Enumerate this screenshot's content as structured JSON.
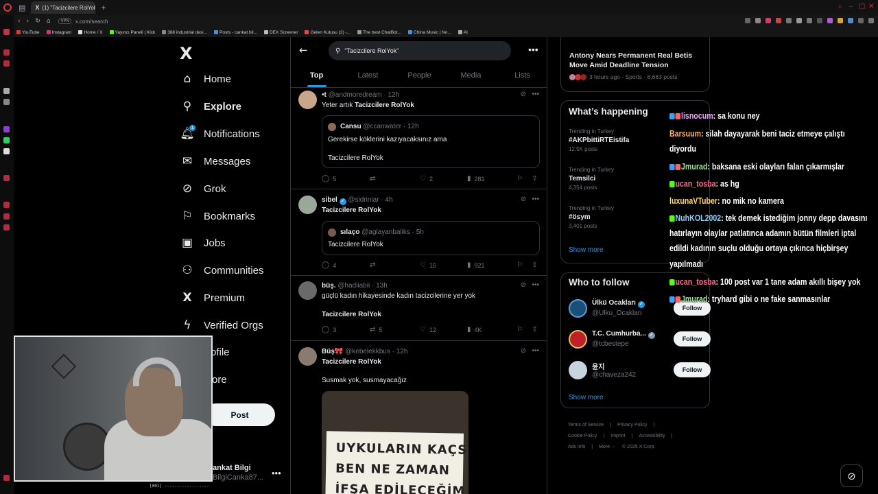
{
  "browser": {
    "tab_title": "(1) \"Tacizcilere RolYok\" -",
    "new_tab_symbol": "+",
    "url": "x.com/search",
    "vpn_label": "VPN",
    "bookmarks": [
      "YouTube",
      "Instagram",
      "Home / X",
      "Yayıncı Paneli | Kick",
      "388 industrial desi...",
      "Posts - cankat bil...",
      "DEX Screener",
      "Gelen Kutusu (2) -...",
      "The best ChatBot...",
      "China Music | No...",
      "AI"
    ]
  },
  "nav": {
    "logo": "X",
    "items": [
      "Home",
      "Explore",
      "Notifications",
      "Messages",
      "Grok",
      "Bookmarks",
      "Jobs",
      "Communities",
      "Premium",
      "Verified Orgs",
      "ofile",
      "ore"
    ],
    "notif_count": "1",
    "post_label": "Post",
    "profile_name": "ankat Bilgi",
    "profile_handle": "BilgiCanka87...",
    "profile_more": "•••"
  },
  "search": {
    "query": "\"Tacizcilere RolYok\"",
    "more": "•••",
    "tabs": [
      "Top",
      "Latest",
      "People",
      "Media",
      "Lists"
    ]
  },
  "tweets": [
    {
      "name": "•t",
      "handle": "@andmoredream",
      "time": "· 12h",
      "text": "Yeter artık ",
      "text_bold": "Tacizcilere RolYok",
      "quote": {
        "name": "Cansu",
        "handle": "@ccanwater",
        "time": "· 12h",
        "line1": "Gerekirse köklerini kazıyacaksınız ama",
        "line2": "Tacizcilere RolYok"
      },
      "replies": "5",
      "reposts": "",
      "likes": "2",
      "views": "281"
    },
    {
      "name": "sibel",
      "handle": "@sidriniar",
      "time": "· 4h",
      "text": "Tacizcilere RolYok",
      "quote": {
        "name": "sılaço",
        "handle": "@aglayanbaliks",
        "time": "· 5h",
        "line1": "Tacizcilere RolYok"
      },
      "replies": "4",
      "reposts": "",
      "likes": "15",
      "views": "921"
    },
    {
      "name": "büş.",
      "handle": "@hadiiabii",
      "time": "· 13h",
      "text": "güçlü kadın hikayesinde kadın tacizcilerine yer yok",
      "text2": "Tacizcilere RolYok",
      "replies": "3",
      "reposts": "5",
      "likes": "12",
      "views": "4K"
    },
    {
      "name": "Büş🎀",
      "handle": "@kebelekkbus",
      "time": "· 12h",
      "text": "Tacizcilere RolYok",
      "text2": "Susmak yok, susmayacağız",
      "sign_lines": [
        "UYKULARIN KAÇSIN",
        "BEN NE ZAMAN",
        "İFŞA EDİLECEĞİM"
      ]
    }
  ],
  "right": {
    "news_title": "Antony Nears Permanent Real Betis Move Amid Deadline Tension",
    "news_meta": "3 hours ago · Sports · 6,663 posts",
    "happening_title": "What’s happening",
    "trends": [
      {
        "sub": "Trending in Turkey",
        "name": "#AKPbittiRTEistifa",
        "count": "12.5K posts"
      },
      {
        "sub": "Trending in Turkey",
        "name": "Temsilci",
        "count": "4,354 posts"
      },
      {
        "sub": "Trending in Turkey",
        "name": "#ösym",
        "count": "3,401 posts"
      }
    ],
    "show_more": "Show more",
    "follow_title": "Who to follow",
    "follows": [
      {
        "name": "Ülkü Ocakları",
        "handle": "@Ulku_Ocaklari",
        "button": "Follow"
      },
      {
        "name": "T.C. Cumhurba...",
        "handle": "@tcbestepe",
        "button": "Follow"
      },
      {
        "name": "윤지",
        "handle": "@chaveza242",
        "button": "Follow"
      }
    ],
    "show_more2": "Show more",
    "footer": [
      "Terms of Service",
      "|",
      "Privacy Policy",
      "|",
      "Cookie Policy",
      "|",
      "Imprint",
      "|",
      "Accessibility",
      "|",
      "Ads info",
      "|",
      "More ···",
      "© 2025 X Corp."
    ]
  },
  "chat": [
    {
      "user": "lisnocum",
      "color": "#f0a0ff",
      "msg": ": sa konu ney"
    },
    {
      "user": "Barsuum",
      "color": "#ffb347",
      "msg": ": silah dayayarak beni taciz etmeye çalıştı"
    },
    {
      "user": "",
      "color": "",
      "msg": "diyordu"
    },
    {
      "user": "Jmurad",
      "color": "#9be58f",
      "msg": ": baksana eski olayları falan çıkarmışlar"
    },
    {
      "user": "ucan_tosba",
      "color": "#ff6b8a",
      "msg": ": as hg"
    },
    {
      "user": "luxunaVTuber",
      "color": "#ffd84d",
      "msg": ": no mik no kamera"
    },
    {
      "user": "NuhKOL2002",
      "color": "#7fd3ff",
      "msg": ": tek demek istediğim jonny depp davasını"
    },
    {
      "user": "",
      "color": "",
      "msg": "hatırlayın olaylar patlatınca adamın bütün filmleri iptal"
    },
    {
      "user": "",
      "color": "",
      "msg": "edildi kadının suçlu olduğu ortaya çıkınca hiçbirşey"
    },
    {
      "user": "",
      "color": "",
      "msg": "yapılmadı"
    },
    {
      "user": "ucan_tosba",
      "color": "#ff6b8a",
      "msg": ": 100 post var 1 tane adam akıllı bişey yok"
    },
    {
      "user": "Jmurad",
      "color": "#9be58f",
      "msg": ": tryhard gibi o ne fake sanmasınlar"
    }
  ],
  "webcam": {
    "status": "[001] ------------------"
  },
  "icons": {
    "home": "home-icon",
    "explore": "search-icon",
    "notifications": "bell-icon",
    "messages": "envelope-icon",
    "grok": "grok-icon",
    "bookmarks": "bookmark-icon",
    "jobs": "briefcase-icon",
    "communities": "people-icon",
    "premium": "x-icon",
    "verified_orgs": "lightning-icon"
  },
  "colors": {
    "accent": "#1d9bf0",
    "background": "#000000",
    "text": "#e7e9ea",
    "muted": "#71767b",
    "border": "#2f3336"
  }
}
